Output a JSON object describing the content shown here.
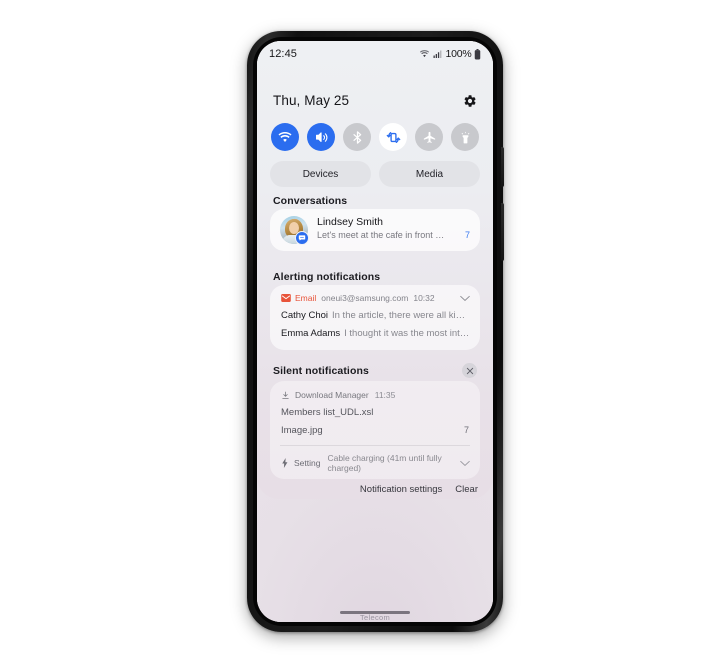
{
  "device": {
    "frame_color": "#111111",
    "carrier_label": "Telecom"
  },
  "status_bar": {
    "clock": "12:45",
    "wifi_icon": "wifi-icon",
    "signal_icon": "cellular-signal-icon",
    "battery_percent": "100%",
    "battery_icon": "battery-full-icon"
  },
  "shade_header": {
    "date": "Thu, May 25",
    "settings_icon": "gear-icon"
  },
  "quick_settings": {
    "toggles": [
      {
        "name": "wifi",
        "icon": "wifi-icon",
        "state": "on"
      },
      {
        "name": "sound",
        "icon": "volume-icon",
        "state": "on"
      },
      {
        "name": "bluetooth",
        "icon": "bluetooth-icon",
        "state": "off"
      },
      {
        "name": "auto-rotate",
        "icon": "auto-rotate-icon",
        "state": "onlight"
      },
      {
        "name": "airplane",
        "icon": "airplane-icon",
        "state": "off"
      },
      {
        "name": "flashlight",
        "icon": "flashlight-icon",
        "state": "off"
      }
    ],
    "buttons": [
      {
        "label": "Devices"
      },
      {
        "label": "Media"
      }
    ],
    "accent_on": "#2b6def",
    "accent_off": "#c8c9cd"
  },
  "sections": {
    "conversations_title": "Conversations",
    "alerting_title": "Alerting notifications",
    "silent_title": "Silent notifications",
    "silent_close_icon": "close-icon"
  },
  "conversation": {
    "avatar": "avatar",
    "badge_icon": "message-bubble-icon",
    "name": "Lindsey Smith",
    "message": "Let's meet at the cafe in front of the coff...",
    "count": "7",
    "count_color": "#3a7bf0"
  },
  "alerting_notification": {
    "app_icon": "email-icon",
    "app_name": "Email",
    "account": "oneui3@samsung.com",
    "time": "10:32",
    "expand_icon": "chevron-down-icon",
    "app_color": "#e8533a",
    "rows": [
      {
        "sender": "Cathy Choi",
        "preview": "In the article, there were all kinds of wond..."
      },
      {
        "sender": "Emma Adams",
        "preview": "I thought it was the most interesting th..."
      }
    ]
  },
  "silent_notifications": {
    "download": {
      "app_icon": "download-icon",
      "app_name": "Download Manager",
      "time": "11:35",
      "files": [
        {
          "name": "Members list_UDL.xsl",
          "count": ""
        },
        {
          "name": "Image.jpg",
          "count": "7"
        }
      ]
    },
    "setting": {
      "app_icon": "charging-bolt-icon",
      "app_name": "Setting",
      "text": "Cable charging (41m until fully charged)",
      "expand_icon": "chevron-down-icon"
    }
  },
  "footer": {
    "notification_settings": "Notification settings",
    "clear": "Clear"
  }
}
